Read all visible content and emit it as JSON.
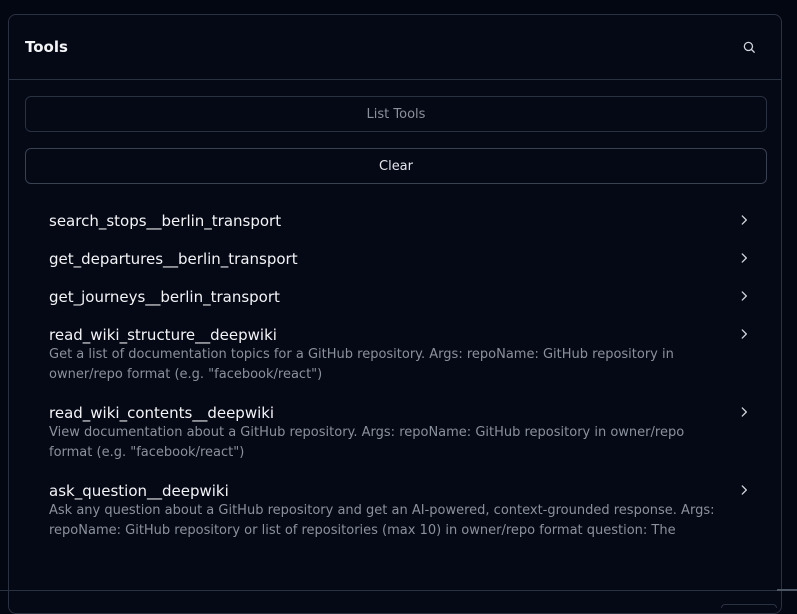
{
  "panel": {
    "title": "Tools",
    "search_icon": "search-icon"
  },
  "actions": {
    "list_label": "List Tools",
    "clear_label": "Clear"
  },
  "tools": [
    {
      "name": "search_stops__berlin_transport",
      "description": ""
    },
    {
      "name": "get_departures__berlin_transport",
      "description": ""
    },
    {
      "name": "get_journeys__berlin_transport",
      "description": ""
    },
    {
      "name": "read_wiki_structure__deepwiki",
      "description": "Get a list of documentation topics for a GitHub repository. Args: repoName: GitHub repository in owner/repo format (e.g. \"facebook/react\")"
    },
    {
      "name": "read_wiki_contents__deepwiki",
      "description": "View documentation about a GitHub repository. Args: repoName: GitHub repository in owner/repo format (e.g. \"facebook/react\")"
    },
    {
      "name": "ask_question__deepwiki",
      "description": "Ask any question about a GitHub repository and get an AI-powered, context-grounded response. Args: repoName: GitHub repository or list of repositories (max 10) in owner/repo format question: The"
    }
  ],
  "colors": {
    "background": "#030712",
    "border": "#2a3140",
    "muted_text": "#8b919c",
    "text": "#f3f4f6"
  }
}
